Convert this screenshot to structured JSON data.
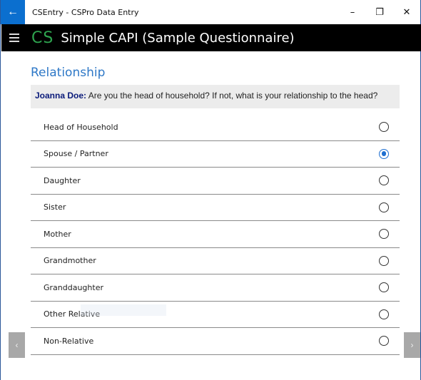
{
  "window": {
    "title": "CSEntry - CSPro Data Entry",
    "back_glyph": "←",
    "minimize_glyph": "–",
    "restore_glyph": "❐",
    "close_glyph": "✕"
  },
  "appbar": {
    "logo_text": "CS",
    "app_name": "Simple CAPI (Sample Questionnaire)"
  },
  "field": {
    "title": "Relationship",
    "question_name": "Joanna Doe:",
    "question_text": " Are you the head of household? If not, what is your relationship to the head?"
  },
  "options": [
    {
      "label": "Head of Household",
      "selected": false
    },
    {
      "label": "Spouse / Partner",
      "selected": true
    },
    {
      "label": "Daughter",
      "selected": false
    },
    {
      "label": "Sister",
      "selected": false
    },
    {
      "label": "Mother",
      "selected": false
    },
    {
      "label": "Grandmother",
      "selected": false
    },
    {
      "label": "Granddaughter",
      "selected": false
    },
    {
      "label": "Other Relative",
      "selected": false
    },
    {
      "label": "Non-Relative",
      "selected": false
    }
  ],
  "nav": {
    "prev_glyph": "‹",
    "next_glyph": "›"
  },
  "colors": {
    "accent": "#1e6fd0",
    "logo_green": "#2ea44f",
    "title_blue": "#2e78c7",
    "appbar_bg": "#000000"
  }
}
